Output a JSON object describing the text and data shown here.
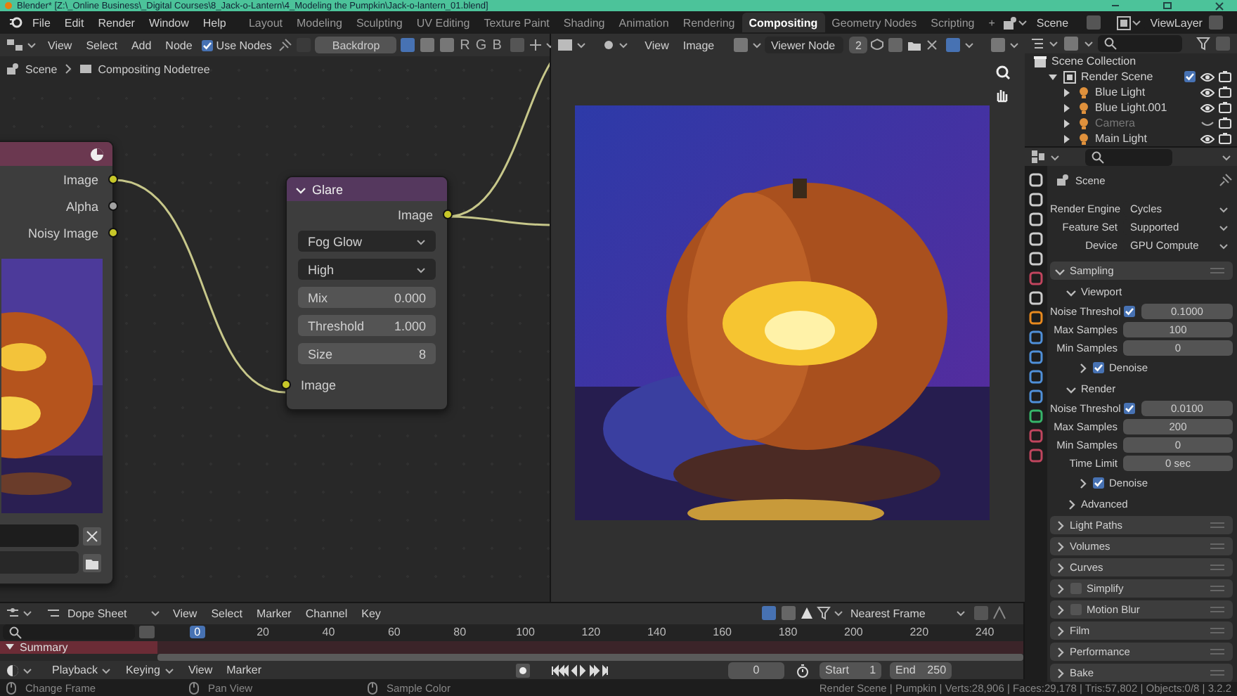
{
  "title_bar": {
    "title": "Blender* [Z:\\_Online Business\\_Digital Courses\\8_Jack-o-Lantern\\4_Modeling the Pumpkin\\Jack-o-lantern_01.blend]"
  },
  "menu": [
    "File",
    "Edit",
    "Render",
    "Window",
    "Help"
  ],
  "workspaces": [
    {
      "label": "Layout",
      "selected": false
    },
    {
      "label": "Modeling",
      "selected": false
    },
    {
      "label": "Sculpting",
      "selected": false
    },
    {
      "label": "UV Editing",
      "selected": false
    },
    {
      "label": "Texture Paint",
      "selected": false
    },
    {
      "label": "Shading",
      "selected": false
    },
    {
      "label": "Animation",
      "selected": false
    },
    {
      "label": "Rendering",
      "selected": false
    },
    {
      "label": "Compositing",
      "selected": true
    },
    {
      "label": "Geometry Nodes",
      "selected": false
    },
    {
      "label": "Scripting",
      "selected": false
    }
  ],
  "add_workspace": "+",
  "scene": "Scene",
  "view_layer": "ViewLayer",
  "node_editor": {
    "menus": [
      "View",
      "Select",
      "Add",
      "Node"
    ],
    "use_nodes": {
      "label": "Use Nodes",
      "checked": true
    },
    "backdrop": "Backdrop",
    "channels": [
      "R",
      "G",
      "B"
    ],
    "breadcrumbs": [
      "Scene",
      "Compositing Nodetree"
    ],
    "left_node": {
      "outputs": [
        {
          "label": "Image",
          "color": "#c7c729"
        },
        {
          "label": "Alpha",
          "color": "#a1a1a1"
        },
        {
          "label": "Noisy Image",
          "color": "#c7c729"
        }
      ]
    },
    "glare": {
      "title": "Glare",
      "output": "Image",
      "glare_type": "Fog Glow",
      "quality": "High",
      "fields": [
        {
          "label": "Mix",
          "value": "0.000"
        },
        {
          "label": "Threshold",
          "value": "1.000"
        },
        {
          "label": "Size",
          "value": "8"
        }
      ],
      "input": "Image"
    }
  },
  "image_editor": {
    "menus": [
      "View",
      "Image"
    ],
    "image_name": "Viewer Node",
    "users": "2"
  },
  "outliner": {
    "items": [
      {
        "label": "Scene Collection",
        "children": [
          {
            "label": "Render Scene",
            "expanded": true,
            "disabled": false,
            "included": true,
            "children": [
              {
                "label": "Blue Light",
                "expanded": false,
                "disabled": false
              },
              {
                "label": "Blue Light.001",
                "expanded": false,
                "disabled": false
              },
              {
                "label": "Camera",
                "expanded": false,
                "disabled": true
              },
              {
                "label": "Main Light",
                "expanded": false,
                "disabled": false
              }
            ]
          }
        ]
      }
    ]
  },
  "properties": {
    "context": "Scene",
    "settings": [
      {
        "label": "Render Engine",
        "value": "Cycles"
      },
      {
        "label": "Feature Set",
        "value": "Supported"
      },
      {
        "label": "Device",
        "value": "GPU Compute"
      }
    ],
    "panels": [
      {
        "title": "Sampling",
        "kind": "plain",
        "expanded": true,
        "children": [
          {
            "title": "Viewport",
            "kind": "plain",
            "expanded": true,
            "rows": [
              {
                "kind": "threshold",
                "label": "Noise Threshol",
                "checked": true,
                "value": "0.1000"
              },
              {
                "kind": "field",
                "label": "Max Samples",
                "value": "100"
              },
              {
                "kind": "field",
                "label": "Min Samples",
                "value": "0"
              }
            ],
            "children": [
              {
                "title": "Denoise",
                "kind": "toggle",
                "checked": true,
                "expanded": false
              }
            ]
          },
          {
            "title": "Render",
            "kind": "plain",
            "expanded": true,
            "rows": [
              {
                "kind": "threshold",
                "label": "Noise Threshol",
                "checked": true,
                "value": "0.0100"
              },
              {
                "kind": "field",
                "label": "Max Samples",
                "value": "200"
              },
              {
                "kind": "field",
                "label": "Min Samples",
                "value": "0"
              },
              {
                "kind": "field",
                "label": "Time Limit",
                "value": "0 sec"
              }
            ],
            "children": [
              {
                "title": "Denoise",
                "kind": "toggle",
                "checked": true,
                "expanded": false
              }
            ]
          },
          {
            "title": "Advanced",
            "kind": "plain",
            "expanded": false
          }
        ]
      },
      {
        "title": "Light Paths",
        "kind": "plain",
        "expanded": false
      },
      {
        "title": "Volumes",
        "kind": "plain",
        "expanded": false
      },
      {
        "title": "Curves",
        "kind": "plain",
        "expanded": false
      },
      {
        "title": "Simplify",
        "kind": "toggle",
        "checked": false,
        "expanded": false
      },
      {
        "title": "Motion Blur",
        "kind": "toggle",
        "checked": false,
        "expanded": false
      },
      {
        "title": "Film",
        "kind": "plain",
        "expanded": false
      },
      {
        "title": "Performance",
        "kind": "plain",
        "expanded": false
      },
      {
        "title": "Bake",
        "kind": "plain",
        "expanded": false
      }
    ]
  },
  "timeline": {
    "editor": "Dope Sheet",
    "menus": [
      "View",
      "Select",
      "Marker",
      "Channel",
      "Key"
    ],
    "snap": "Nearest Frame",
    "ticks": [
      {
        "label": "0",
        "selected": true
      },
      {
        "label": "20",
        "selected": false
      },
      {
        "label": "40",
        "selected": false
      },
      {
        "label": "60",
        "selected": false
      },
      {
        "label": "80",
        "selected": false
      },
      {
        "label": "100",
        "selected": false
      },
      {
        "label": "120",
        "selected": false
      },
      {
        "label": "140",
        "selected": false
      },
      {
        "label": "160",
        "selected": false
      },
      {
        "label": "180",
        "selected": false
      },
      {
        "label": "200",
        "selected": false
      },
      {
        "label": "220",
        "selected": false
      },
      {
        "label": "240",
        "selected": false
      }
    ],
    "channel": "Summary",
    "playback_menus": [
      "Playback",
      "Keying"
    ],
    "playback_plain_menus": [
      "View",
      "Marker"
    ],
    "frame": "0",
    "start": {
      "label": "Start",
      "value": "1"
    },
    "end": {
      "label": "End",
      "value": "250"
    }
  },
  "status_bar": {
    "hints": [
      "Change Frame",
      "Pan View",
      "Sample Color"
    ],
    "stats": "Render Scene | Pumpkin | Verts:28,906 | Faces:29,178 | Tris:57,802 | Objects:0/8 | 3.2.2"
  }
}
